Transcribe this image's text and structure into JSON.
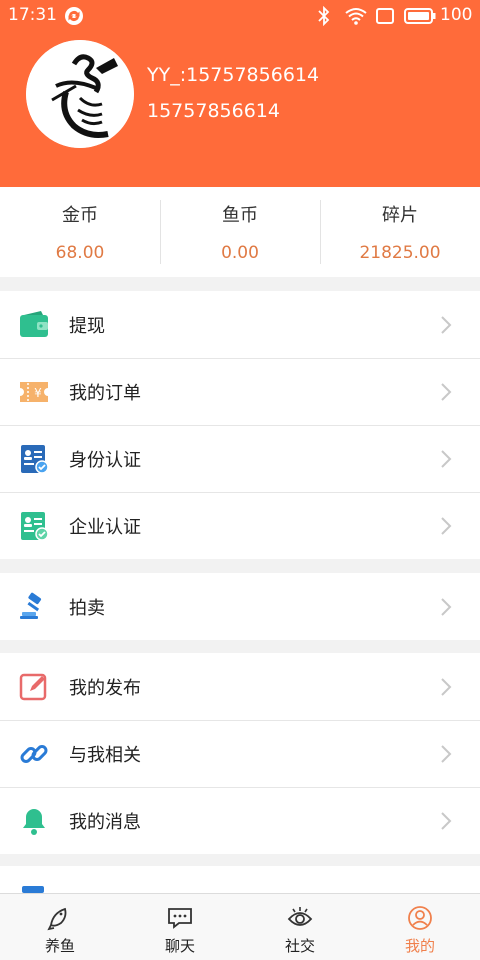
{
  "status_bar": {
    "time": "17:31",
    "battery": "100",
    "icons": [
      "sync-icon",
      "bluetooth-icon",
      "wifi-icon",
      "screen-icon",
      "battery-icon"
    ]
  },
  "profile": {
    "name": "YY_:15757856614",
    "phone": "15757856614"
  },
  "balances": [
    {
      "label": "金币",
      "value": "68.00"
    },
    {
      "label": "鱼币",
      "value": "0.00"
    },
    {
      "label": "碎片",
      "value": "21825.00"
    }
  ],
  "menu": {
    "group1": [
      {
        "label": "提现",
        "icon": "wallet-icon"
      },
      {
        "label": "我的订单",
        "icon": "order-ticket-icon"
      },
      {
        "label": "身份认证",
        "icon": "id-card-icon"
      },
      {
        "label": "企业认证",
        "icon": "enterprise-cert-icon"
      }
    ],
    "group2": [
      {
        "label": "拍卖",
        "icon": "auction-gavel-icon"
      }
    ],
    "group3": [
      {
        "label": "我的发布",
        "icon": "edit-post-icon"
      },
      {
        "label": "与我相关",
        "icon": "link-icon"
      },
      {
        "label": "我的消息",
        "icon": "bell-icon"
      }
    ]
  },
  "tabs": [
    {
      "label": "养鱼",
      "icon": "fish-icon"
    },
    {
      "label": "聊天",
      "icon": "chat-icon"
    },
    {
      "label": "社交",
      "icon": "eye-icon"
    },
    {
      "label": "我的",
      "icon": "user-circle-icon",
      "active": true
    }
  ],
  "colors": {
    "header": "#ff6b3a",
    "balance_value": "#e07a44",
    "active_tab": "#f0804c"
  }
}
